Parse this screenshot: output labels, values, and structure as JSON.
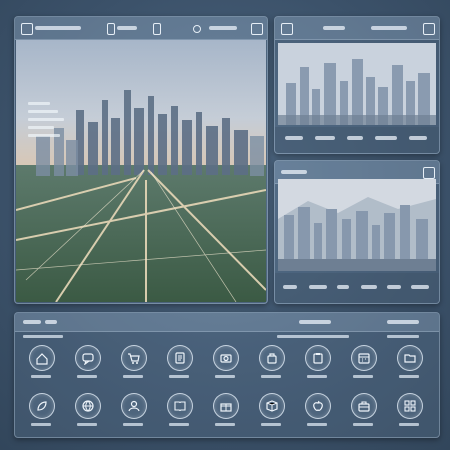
{
  "window": {
    "main_panel": "city-overview",
    "thumbnails": [
      "skyline-day",
      "skyline-haze"
    ]
  },
  "colors": {
    "background": "#3a4f66",
    "panel": "#7896b4",
    "accent": "#e6eef6"
  },
  "dock": {
    "row1": [
      "home-icon",
      "chat-icon",
      "cart-icon",
      "document-icon",
      "camera-icon",
      "bag-icon",
      "clipboard-icon",
      "calendar-icon",
      "folder-icon"
    ],
    "row2": [
      "leaf-icon",
      "globe-icon",
      "user-icon",
      "book-icon",
      "gift-icon",
      "box-icon",
      "apple-icon",
      "briefcase-icon",
      "grid-icon"
    ]
  }
}
